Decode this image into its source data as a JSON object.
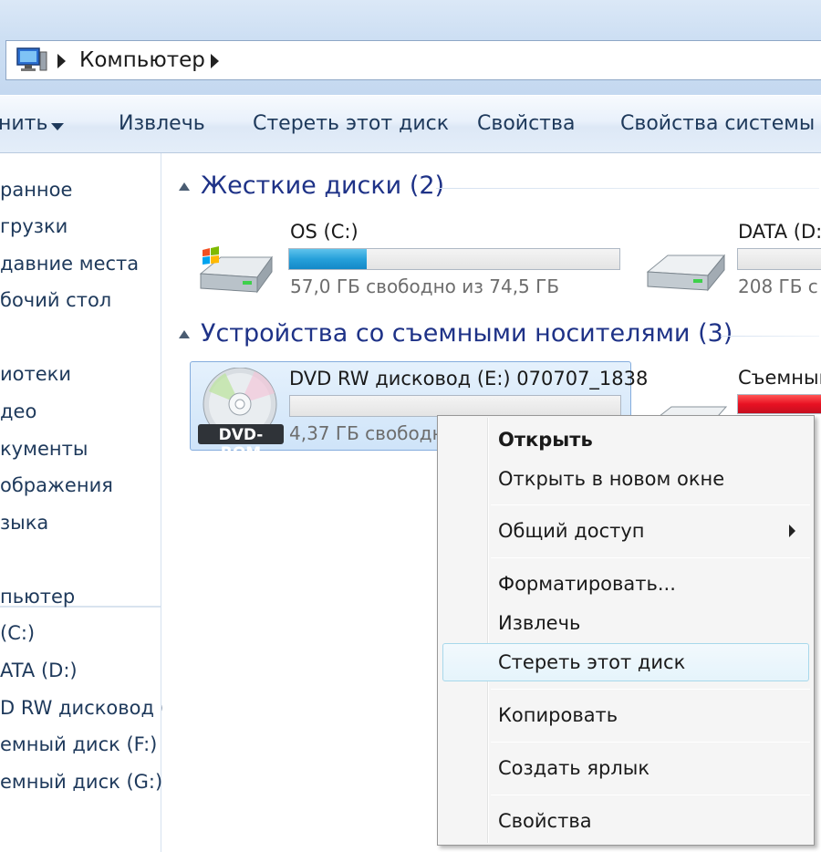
{
  "address_bar": {
    "location": "Компьютер"
  },
  "toolbar": {
    "organize_label": "нить",
    "eject_label": "Извлечь",
    "erase_label": "Стереть этот диск",
    "properties_label": "Свойства",
    "system_properties_label": "Свойства системы"
  },
  "nav": {
    "items": [
      "ранное",
      "грузки",
      "давние места",
      "бочий стол",
      "иотеки",
      "део",
      "кументы",
      "ображения",
      "зыка",
      "пьютер",
      "(C:)",
      "ATA (D:)",
      "D RW дисковод (",
      "емный диск (F:)",
      "емный диск (G:)"
    ]
  },
  "groups": {
    "hard_disks_title": "Жесткие диски (2)",
    "removable_title": "Устройства со съемными носителями (3)"
  },
  "drives": {
    "c": {
      "name": "OS (C:)",
      "free_text": "57,0 ГБ свободно из 74,5 ГБ",
      "used_fraction": 0.235
    },
    "d": {
      "name": "DATA (D:",
      "free_text": "208 ГБ с"
    },
    "e": {
      "name": "DVD RW дисковод (E:) 070707_1838",
      "free_text": "4,37 ГБ свободно",
      "icon_label": "DVD-ROM",
      "used_fraction": 0.0
    },
    "f": {
      "name": "Съемный"
    }
  },
  "context_menu": {
    "items": {
      "open": "Открыть",
      "open_new_window": "Открыть в новом окне",
      "share": "Общий доступ",
      "format": "Форматировать...",
      "eject": "Извлечь",
      "erase": "Стереть этот диск",
      "copy": "Копировать",
      "create_shortcut": "Создать ярлык",
      "properties": "Свойства"
    },
    "highlighted": "Стереть этот диск"
  },
  "colors": {
    "accent_blue": "#26a0da",
    "removable_red": "#e81123",
    "group_title": "#1e3287"
  }
}
